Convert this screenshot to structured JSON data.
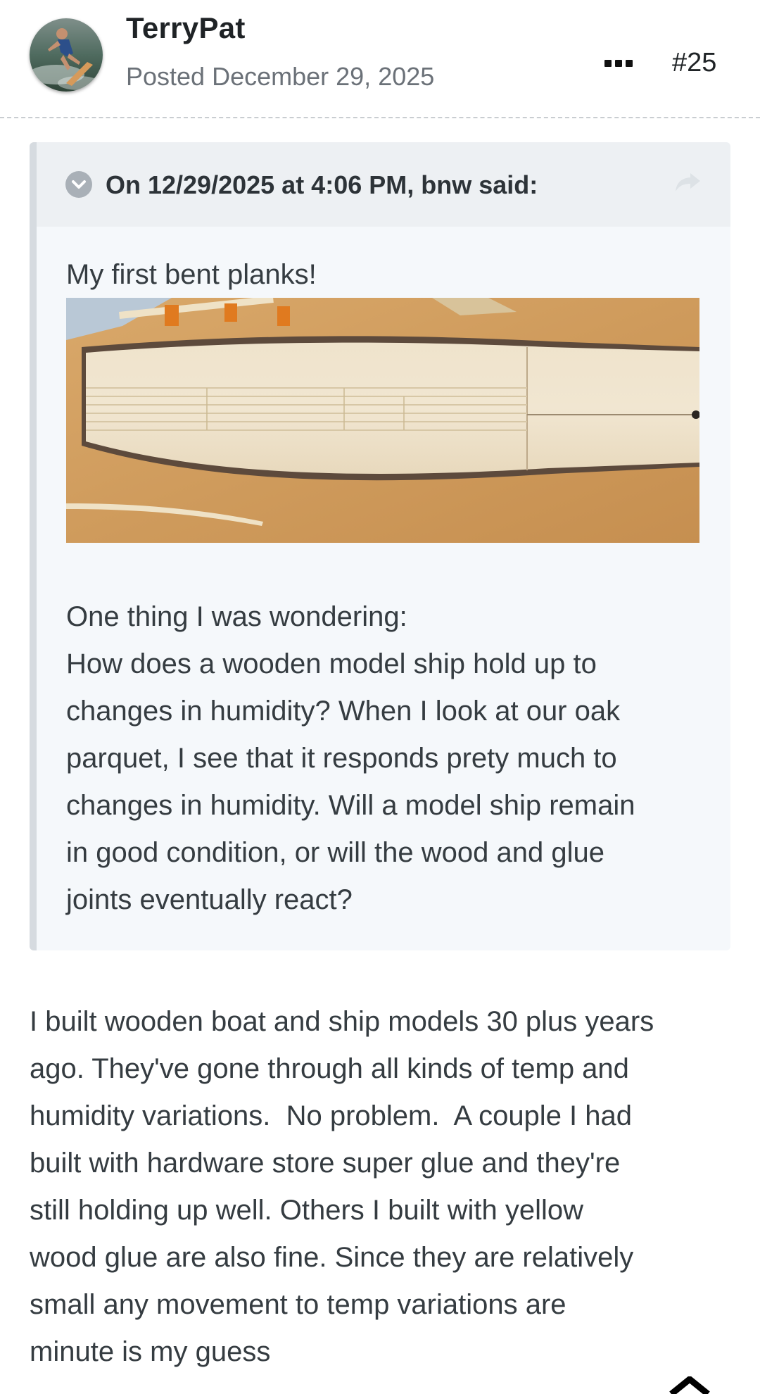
{
  "post": {
    "author": "TerryPat",
    "posted": "Posted December 29, 2025",
    "number": "#25",
    "more_icon": "ellipsis-icon"
  },
  "quote": {
    "citation": "On 12/29/2025 at 4:06 PM, bnw said:",
    "toggle_icon": "chevron-down-icon",
    "share_icon": "share-arrow-icon",
    "intro": "My first bent planks!",
    "lines": [
      "One thing I was wondering:",
      "How does a wooden model ship hold up to",
      "changes in humidity? When I look at our oak",
      "parquet, I see that it responds prety much to",
      "changes in humidity. Will a model ship remain",
      "in good condition, or will the wood and glue",
      "joints eventually react?"
    ]
  },
  "reply": {
    "lines": [
      "I built wooden boat and ship models 30 plus years",
      "ago. They've gone through all kinds of temp and",
      "humidity variations.  No problem.  A couple I had",
      "built with hardware store super glue and they're",
      "still holding up well. Others I built with yellow",
      "wood glue are also fine. Since they are relatively",
      "small any movement to temp variations are",
      "minute is my guess"
    ]
  },
  "colors": {
    "quote_background": "#f5f8fb",
    "quote_header": "#edf0f3",
    "quote_border": "#d6dbe0",
    "text": "#353c41",
    "muted": "#6b7178"
  }
}
